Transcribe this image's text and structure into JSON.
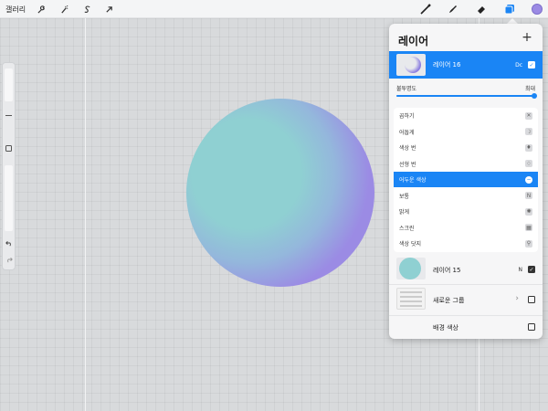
{
  "topbar": {
    "gallery_label": "갤러리",
    "left_tools": [
      "wrench-icon",
      "magic-wand-icon",
      "selection-s-icon",
      "move-arrow-icon"
    ],
    "right_tools": [
      "brush-icon",
      "smudge-icon",
      "eraser-icon",
      "layers-icon",
      "color-swatch"
    ],
    "accent_color": "#1a85f5",
    "current_color": "#9b8ae4"
  },
  "layers_panel": {
    "title": "레이어",
    "add_label": "+",
    "active_layer": {
      "name": "레이어 16",
      "mode": "Dc",
      "visible": true
    },
    "opacity": {
      "label": "불투명도",
      "value_label": "최대",
      "value_fraction": 1.0
    },
    "blend_modes": [
      {
        "label": "곱하기",
        "icon": "multiply-icon",
        "symbol": "✕",
        "selected": false
      },
      {
        "label": "어둡게",
        "icon": "moon-icon",
        "symbol": "☽",
        "selected": false
      },
      {
        "label": "색상 번",
        "icon": "flame-icon",
        "symbol": "♦",
        "selected": false
      },
      {
        "label": "선형 번",
        "icon": "flame-small-icon",
        "symbol": "♢",
        "selected": false
      },
      {
        "label": "어두운 색상",
        "icon": "minus-circle-icon",
        "symbol": "−",
        "selected": true
      },
      {
        "label": "보통",
        "icon": "n-box-icon",
        "symbol": "N",
        "selected": false
      },
      {
        "label": "밝게",
        "icon": "sun-icon",
        "symbol": "✺",
        "selected": false
      },
      {
        "label": "스크린",
        "icon": "screen-grid-icon",
        "symbol": "▦",
        "selected": false
      },
      {
        "label": "색상 닷지",
        "icon": "dodge-icon",
        "symbol": "⚲",
        "selected": false
      }
    ],
    "other_layers": [
      {
        "name": "레이어 15",
        "mode": "N",
        "checked": true
      },
      {
        "name": "새로운 그룹",
        "mode": "",
        "checked": false
      },
      {
        "name": "배경 색상",
        "mode": "",
        "checked": false
      }
    ]
  }
}
